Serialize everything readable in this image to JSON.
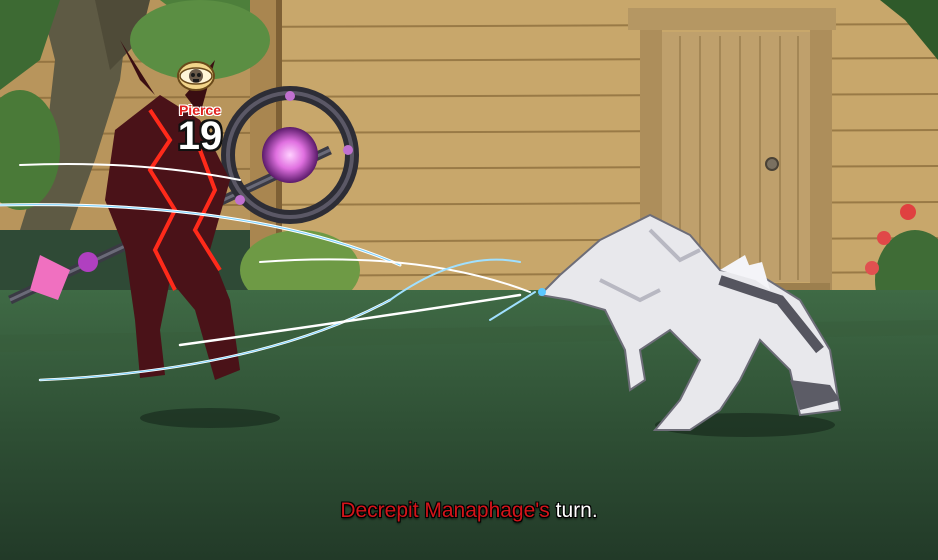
{
  "battle": {
    "turn_banner": {
      "name": "Decrepit Manaphage's",
      "suffix": " turn."
    },
    "damage_popup": {
      "label": "Pierce",
      "value": "19"
    },
    "status_effect": {
      "icon": "skull-eye-icon"
    }
  },
  "colors": {
    "enemy_name": "#d4141a",
    "damage_label": "#e0221e",
    "wall": "#c9a86a",
    "ground": "#2f5233"
  },
  "characters": {
    "player": "dark-armored-hero",
    "enemy": "decrepit-manaphage"
  }
}
